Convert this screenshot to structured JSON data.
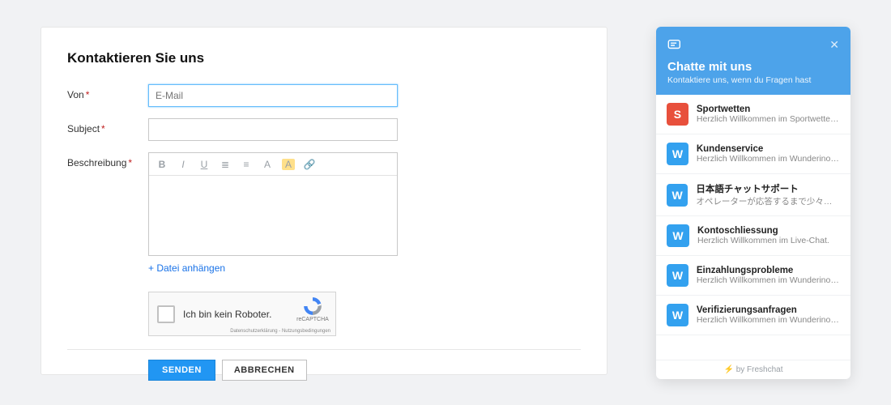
{
  "form": {
    "title": "Kontaktieren Sie uns",
    "labels": {
      "from": "Von",
      "subject": "Subject",
      "description": "Beschreibung"
    },
    "from_placeholder": "E-Mail",
    "attach": "+ Datei anhängen",
    "captcha": {
      "label": "Ich bin kein Roboter.",
      "brand": "reCAPTCHA",
      "links": "Datenschutzerklärung - Nutzungsbedingungen"
    },
    "buttons": {
      "submit": "SENDEN",
      "cancel": "ABBRECHEN"
    },
    "toolbar": {
      "bold": "B",
      "italic": "I",
      "underline": "U",
      "ul": "≣",
      "ol": "≡",
      "font": "A",
      "color": "A",
      "link": "🔗"
    }
  },
  "chat": {
    "title": "Chatte mit uns",
    "subtitle": "Kontaktiere uns, wenn du Fragen hast",
    "footer": "by Freshchat",
    "items": [
      {
        "avatar": "S",
        "kind": "s",
        "title": "Sportwetten",
        "preview": "Herzlich Willkommen im Sportwetten …"
      },
      {
        "avatar": "W",
        "kind": "w",
        "title": "Kundenservice",
        "preview": "Herzlich Willkommen im Wunderino L…"
      },
      {
        "avatar": "W",
        "kind": "w",
        "title": "日本語チャットサポート",
        "preview": "オペレーターが応答するまで少々お待…"
      },
      {
        "avatar": "W",
        "kind": "w",
        "title": "Kontoschliessung",
        "preview": "Herzlich Willkommen im Live-Chat."
      },
      {
        "avatar": "W",
        "kind": "w",
        "title": "Einzahlungsprobleme",
        "preview": "Herzlich Willkommen im Wunderino L…"
      },
      {
        "avatar": "W",
        "kind": "w",
        "title": "Verifizierungsanfragen",
        "preview": "Herzlich Willkommen im Wunderino L…"
      }
    ]
  }
}
